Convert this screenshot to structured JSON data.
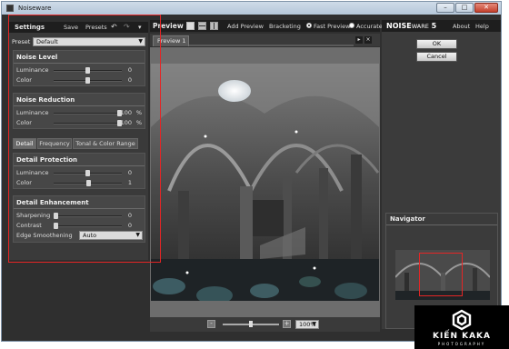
{
  "window": {
    "title": "Noiseware",
    "minimize": "–",
    "maximize": "□",
    "close": "✕"
  },
  "settings": {
    "title": "Settings",
    "save_label": "Save",
    "presets_label": "Presets",
    "undo_icon": "↶",
    "redo_icon": "↷",
    "menu_icon": "▾",
    "preset_label": "Preset",
    "preset_value": "Default",
    "noise_level": {
      "title": "Noise Level",
      "luminance_label": "Luminance",
      "luminance_value": "0",
      "luminance_pos": 0.5,
      "color_label": "Color",
      "color_value": "0",
      "color_pos": 0.5
    },
    "noise_reduction": {
      "title": "Noise Reduction",
      "luminance_label": "Luminance",
      "luminance_value": "100",
      "luminance_unit": "%",
      "luminance_pos": 1.0,
      "color_label": "Color",
      "color_value": "100",
      "color_unit": "%",
      "color_pos": 1.0
    },
    "tabs": [
      "Detail",
      "Frequency",
      "Tonal & Color Range"
    ],
    "detail_protection": {
      "title": "Detail Protection",
      "luminance_label": "Luminance",
      "luminance_value": "0",
      "luminance_pos": 0.5,
      "color_label": "Color",
      "color_value": "1",
      "color_pos": 0.52
    },
    "detail_enhancement": {
      "title": "Detail Enhancement",
      "sharpening_label": "Sharpening",
      "sharpening_value": "0",
      "sharpening_pos": 0.0,
      "contrast_label": "Contrast",
      "contrast_value": "0",
      "contrast_pos": 0.0,
      "edge_label": "Edge Smoothening",
      "edge_value": "Auto"
    }
  },
  "preview": {
    "title": "Preview",
    "add_preview": "Add Preview",
    "bracketing": "Bracketing",
    "fast_preview": "Fast Preview",
    "accurate": "Accurate",
    "mode_selected": "Fast Preview",
    "tab_label": "Preview 1",
    "zoom_minus": "-",
    "zoom_plus": "+",
    "zoom_value": "100%",
    "zoom_pos": 0.5
  },
  "brand": {
    "name_bold": "NOISE",
    "name_rest": "WARE",
    "version": "5",
    "about": "About",
    "help": "Help"
  },
  "actions": {
    "ok": "OK",
    "cancel": "Cancel"
  },
  "navigator": {
    "title": "Navigator"
  },
  "watermark": {
    "name": "KIẾN KAKA",
    "sub": "PHOTOGRAPHY"
  },
  "colors": {
    "annotation": "#e42525",
    "panel": "#3a3a3a",
    "group": "#474747"
  }
}
